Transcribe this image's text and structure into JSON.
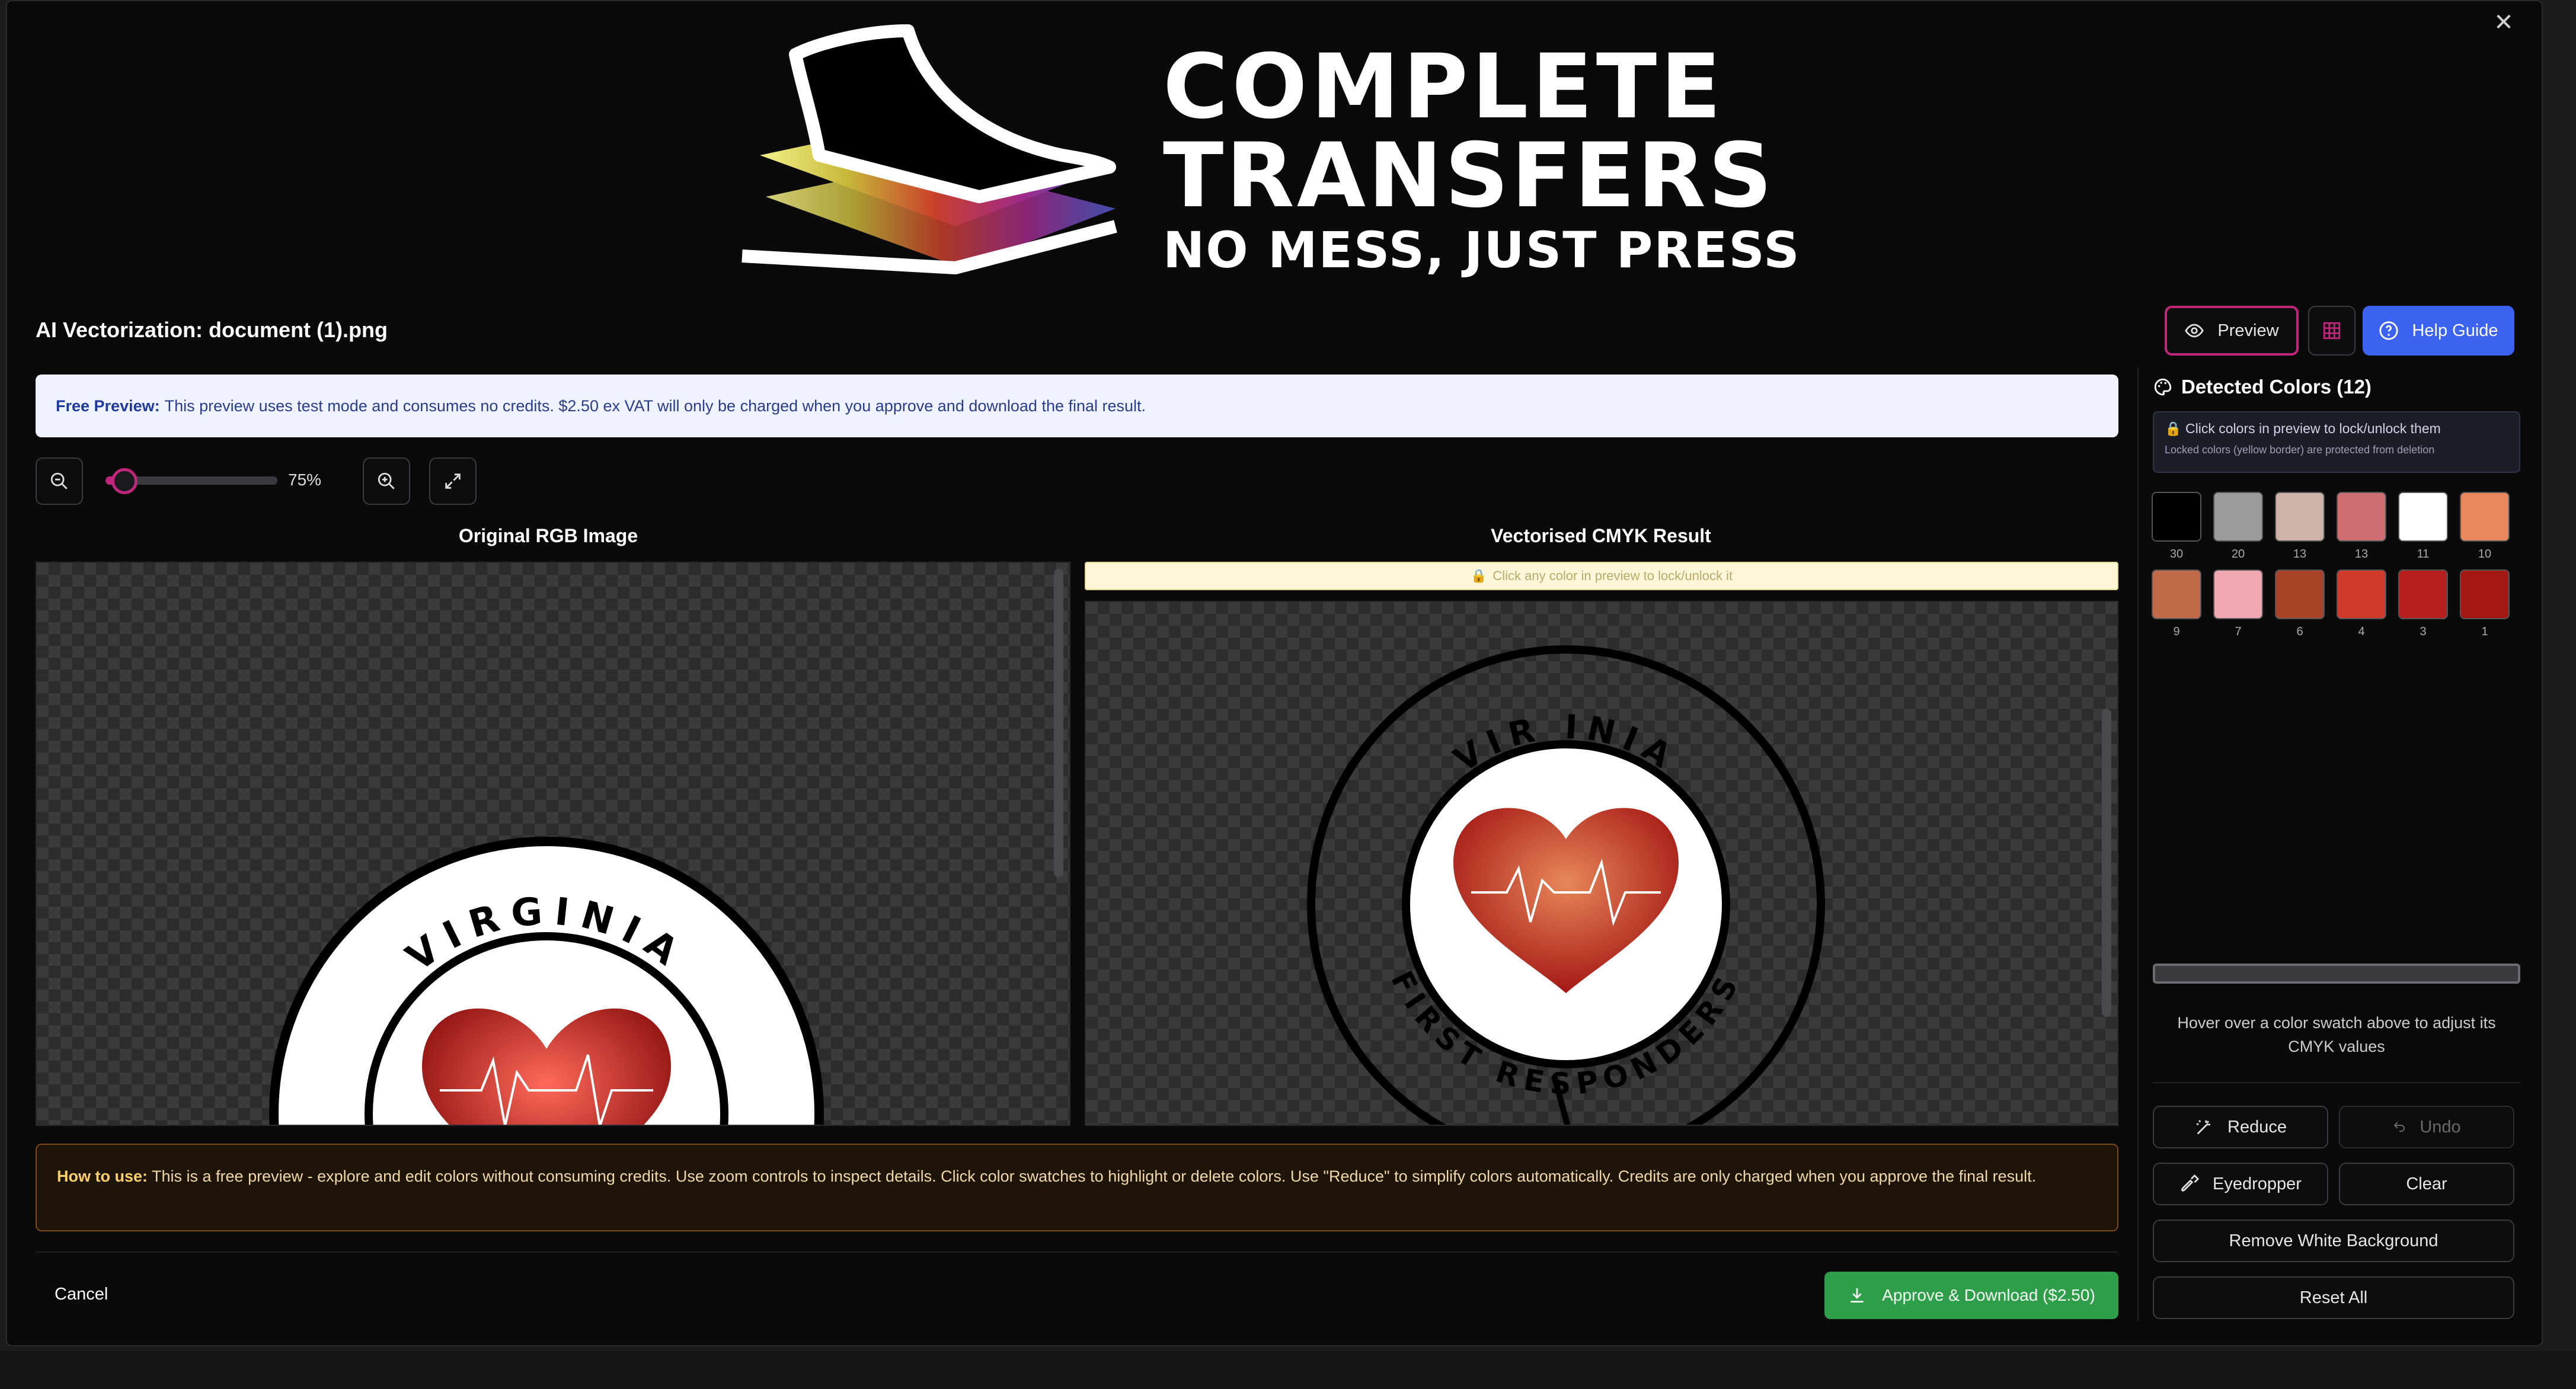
{
  "brand": {
    "line1": "COMPLETE",
    "line2": "TRANSFERS",
    "tagline": "NO MESS, JUST PRESS"
  },
  "header": {
    "title": "AI Vectorization: document (1).png",
    "preview_label": "Preview",
    "help_label": "Help Guide"
  },
  "notice": {
    "strong": "Free Preview:",
    "text": "This preview uses test mode and consumes no credits. $2.50 ex VAT will only be charged when you approve and download the final result."
  },
  "zoom": {
    "value_label": "75%",
    "level": 0.08
  },
  "panels": {
    "left_title": "Original RGB Image",
    "right_title": "Vectorised CMYK Result",
    "right_hint": "Click any color in preview to lock/unlock it"
  },
  "artwork": {
    "top_text": "VIRGINIA",
    "right_top_text": "VIR  INIA",
    "bottom_text": "FIRST RESPONDERS"
  },
  "howto": {
    "strong": "How to use:",
    "text": "This is a free preview - explore and edit colors without consuming credits. Use zoom controls to inspect details. Click color swatches to highlight or delete colors. Use \"Reduce\" to simplify colors automatically. Credits are only charged when you approve the final result."
  },
  "footer": {
    "cancel_label": "Cancel",
    "approve_label": "Approve & Download ($2.50)"
  },
  "sidebar": {
    "title": "Detected Colors (12)",
    "lock_title": "Click colors in preview to lock/unlock them",
    "lock_sub": "Locked colors (yellow border) are protected from deletion",
    "swatches": [
      {
        "color": "#000000",
        "count": "30"
      },
      {
        "color": "#9a9a9a",
        "count": "20"
      },
      {
        "color": "#cfb2a8",
        "count": "13"
      },
      {
        "color": "#cf6f72",
        "count": "13"
      },
      {
        "color": "#ffffff",
        "count": "11"
      },
      {
        "color": "#e8875a",
        "count": "10"
      },
      {
        "color": "#c06a4a",
        "count": "9"
      },
      {
        "color": "#f0a8b0",
        "count": "7"
      },
      {
        "color": "#a8442a",
        "count": "6"
      },
      {
        "color": "#cf3a2a",
        "count": "4"
      },
      {
        "color": "#b81e1e",
        "count": "3"
      },
      {
        "color": "#a41814",
        "count": "1"
      }
    ],
    "hover_hint": "Hover over a color swatch above to adjust its CMYK values",
    "reduce_label": "Reduce",
    "undo_label": "Undo",
    "eyedropper_label": "Eyedropper",
    "clear_label": "Clear",
    "remove_white_label": "Remove White Background",
    "reset_label": "Reset All"
  },
  "colors": {
    "accent_pink": "#c0267a",
    "help_blue": "#3b63f0",
    "approve_green": "#2f9e4a",
    "notice_bg": "#eef3ff",
    "howto_bg": "#1e1408",
    "howto_border": "#7a4a14"
  }
}
